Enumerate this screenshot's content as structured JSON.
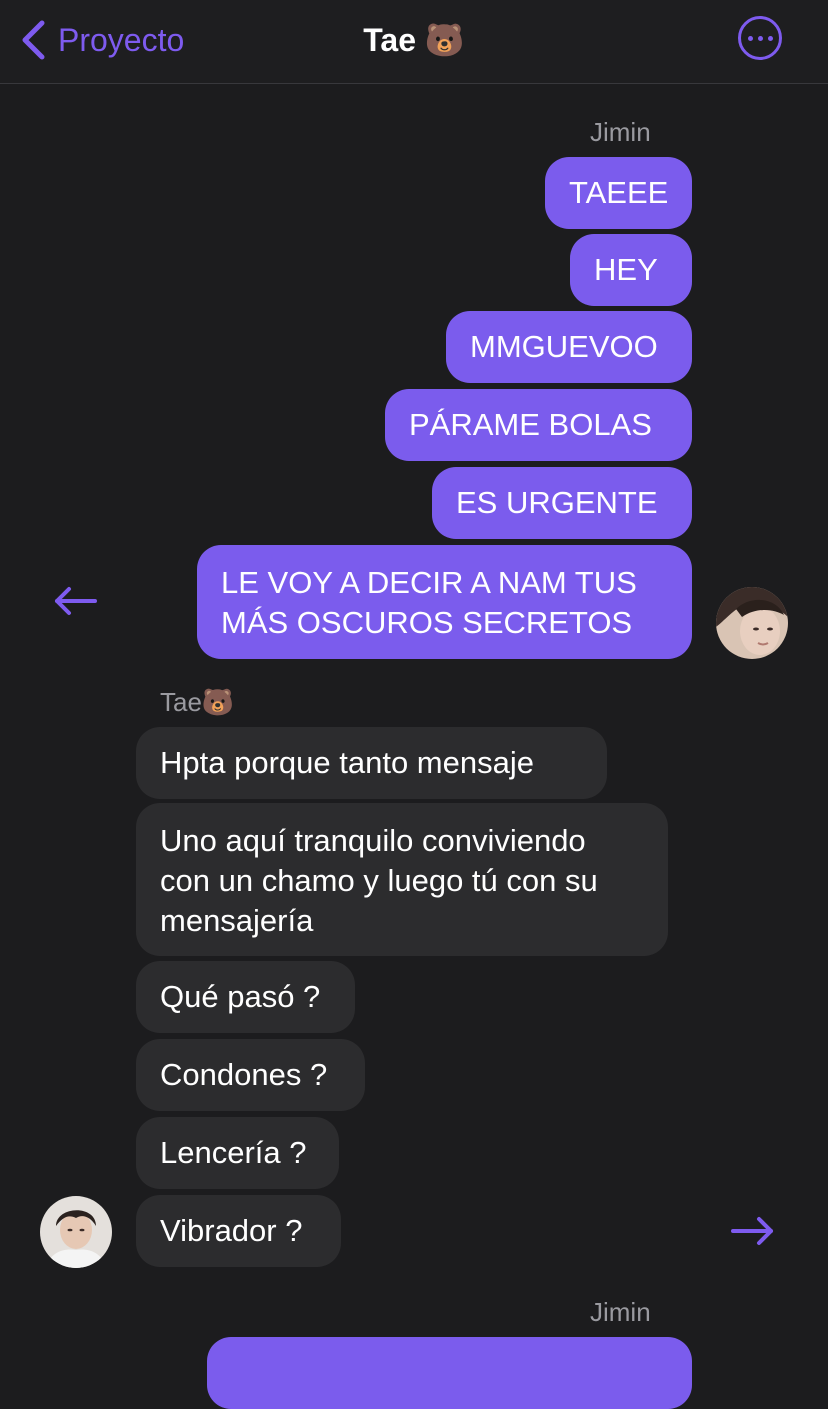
{
  "header": {
    "back_label": "Proyecto",
    "title": "Tae 🐻"
  },
  "colors": {
    "accent": "#7b5ced",
    "background": "#1c1c1e",
    "incoming_bubble": "#2c2c2e"
  },
  "messages": {
    "group1": {
      "sender": "Jimin",
      "items": [
        "TAEEE",
        "HEY",
        "MMGUEVOO",
        "PÁRAME BOLAS",
        "ES URGENTE",
        "LE VOY A DECIR A NAM TUS\nMÁS OSCUROS SECRETOS"
      ]
    },
    "group2": {
      "sender": "Tae🐻",
      "items": [
        "Hpta porque tanto mensaje",
        "Uno aquí tranquilo conviviendo\ncon un chamo y luego tú con su\nmensajería",
        "Qué pasó ?",
        "Condones ?",
        "Lencería ?",
        "Vibrador ?"
      ]
    },
    "group3": {
      "sender": "Jimin"
    }
  },
  "icons": {
    "back": "chevron-left-icon",
    "more": "ellipsis-circle-icon",
    "reply_left": "arrow-left-icon",
    "reply_right": "arrow-right-icon"
  }
}
